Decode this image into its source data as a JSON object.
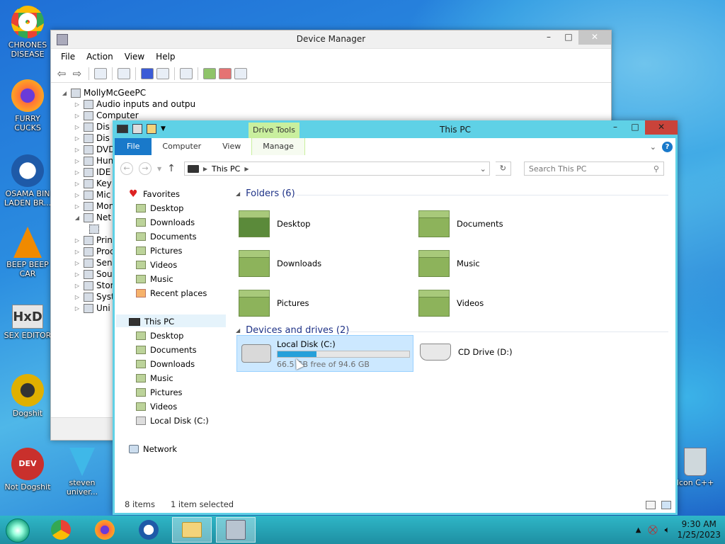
{
  "desktop": {
    "icons": [
      {
        "label": "CHRONES DISEASE",
        "color": "#4285f4"
      },
      {
        "label": "FURRY CUCKS",
        "color": "#ff7139"
      },
      {
        "label": "OSAMA BIN LADEN BR...",
        "color": "#1e5aa8"
      },
      {
        "label": "BEEP BEEP CAR",
        "color": "#f08a00"
      },
      {
        "label": "SEX EDITOR",
        "color": "#c9c9c9"
      },
      {
        "label": "Dogshit",
        "color": "#e0b000"
      },
      {
        "label": "Not Dogshit",
        "color": "#c9302c"
      },
      {
        "label": "steven univer...",
        "color": "#3fb8e8"
      },
      {
        "label": "Icon C++",
        "color": "#cfd8dc"
      }
    ]
  },
  "device_manager": {
    "title": "Device Manager",
    "menu": [
      "File",
      "Action",
      "View",
      "Help"
    ],
    "root": "MollyMcGeePC",
    "nodes": [
      "Audio inputs and outpu",
      "Computer",
      "Dis",
      "Dis",
      "DVD",
      "Hun",
      "IDE",
      "Key",
      "Mic",
      "Mon",
      "Net",
      "",
      "Prin",
      "Proc",
      "Sen",
      "Sou",
      "Stor",
      "Syst",
      "Uni"
    ]
  },
  "explorer": {
    "title": "This PC",
    "contextual_tab": "Drive Tools",
    "tabs": {
      "file": "File",
      "computer": "Computer",
      "view": "View",
      "manage": "Manage"
    },
    "address": "This PC",
    "search_placeholder": "Search This PC",
    "nav": {
      "favorites": "Favorites",
      "fav_items": [
        "Desktop",
        "Downloads",
        "Documents",
        "Pictures",
        "Videos",
        "Music",
        "Recent places"
      ],
      "this_pc": "This PC",
      "pc_items": [
        "Desktop",
        "Documents",
        "Downloads",
        "Music",
        "Pictures",
        "Videos",
        "Local Disk (C:)"
      ],
      "network": "Network"
    },
    "folders_header": "Folders (6)",
    "folders": [
      "Desktop",
      "Documents",
      "Downloads",
      "Music",
      "Pictures",
      "Videos"
    ],
    "devices_header": "Devices and drives (2)",
    "local_disk": {
      "name": "Local Disk (C:)",
      "free_text": "66.5 GB free of 94.6 GB",
      "used_fraction": 0.297
    },
    "cd_drive": "CD Drive (D:)",
    "status": {
      "items": "8 items",
      "selected": "1 item selected"
    },
    "accent": "#1979ca"
  },
  "taskbar": {
    "time": "9:30 AM",
    "date": "1/25/2023"
  }
}
